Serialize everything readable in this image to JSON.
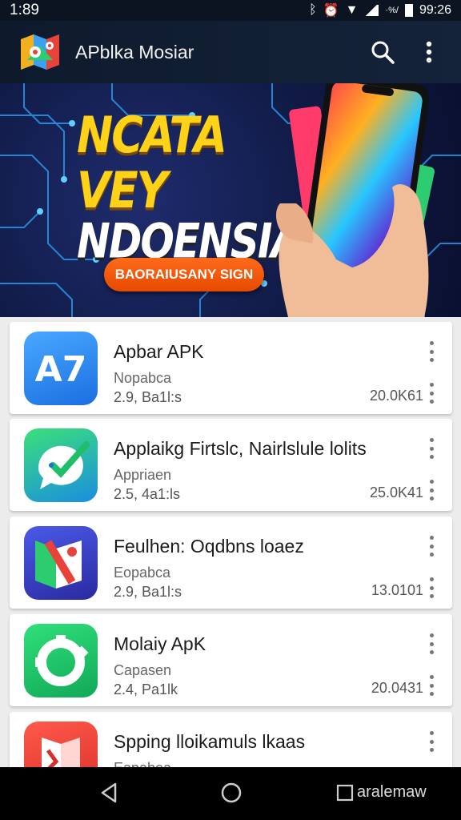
{
  "status_bar": {
    "time": "1:89",
    "clock": "99:26",
    "battery_text": "·%/"
  },
  "app_bar": {
    "title": "APblka Mosiar",
    "logo_icon": "map-pin-logo-icon",
    "search_icon": "search-icon",
    "menu_icon": "more-vert-icon"
  },
  "banner": {
    "headline_line1": "NCATA VEY",
    "headline_line2": "NDOENSIA",
    "cta_label": "BAORAIUSANY SIGN"
  },
  "apps": [
    {
      "name": "Apbar APK",
      "developer": "Nopabca",
      "meta": "2.9, Ba1l:s",
      "count": "20.0K61",
      "icon": "ap-letters-icon",
      "color": "#2f8df0"
    },
    {
      "name": "Applaikg Firtslc, Nairlslule lolits",
      "developer": "Appriaen",
      "meta": "2.5, 4a1:ls",
      "count": "25.0K41",
      "icon": "chat-check-icon",
      "color": "#2ecc71"
    },
    {
      "name": "Feulhen: Oqdbns loaez",
      "developer": "Eopabca",
      "meta": "2.9, Ba1l:s",
      "count": "13.0101",
      "icon": "map-fold-icon",
      "color": "#3a4ad0"
    },
    {
      "name": "Molaiy ApK",
      "developer": "Capasen",
      "meta": "2.4, Pa1lk",
      "count": "20.0431",
      "icon": "gear-ring-icon",
      "color": "#1fbf6a"
    },
    {
      "name": "Spping lloikamuls lkaas",
      "developer": "Eapabea",
      "meta": "",
      "count": "",
      "icon": "shield-book-icon",
      "color": "#e8433a"
    }
  ],
  "nav_bar": {
    "back_icon": "back-triangle-icon",
    "home_icon": "home-circle-icon",
    "recents_label": "aralemaw",
    "recents_icon": "recents-square-icon"
  }
}
